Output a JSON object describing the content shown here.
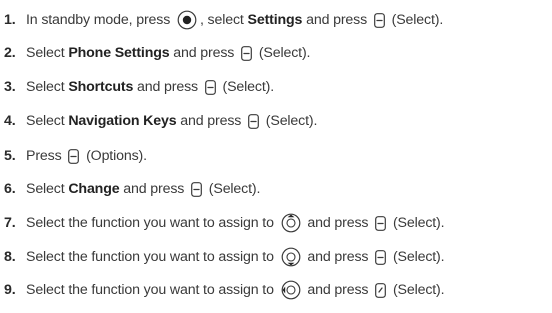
{
  "steps": [
    {
      "num": "1.",
      "parts": [
        {
          "t": "text",
          "v": "In standby mode, press "
        },
        {
          "t": "icon",
          "v": "center-key-icon"
        },
        {
          "t": "text",
          "v": ", select "
        },
        {
          "t": "bold",
          "v": "Settings"
        },
        {
          "t": "text",
          "v": " and press "
        },
        {
          "t": "icon",
          "v": "left-softkey-icon"
        },
        {
          "t": "text",
          "v": " (Select)."
        }
      ]
    },
    {
      "num": "2.",
      "parts": [
        {
          "t": "text",
          "v": "Select "
        },
        {
          "t": "bold",
          "v": "Phone Settings"
        },
        {
          "t": "text",
          "v": " and press "
        },
        {
          "t": "icon",
          "v": "left-softkey-icon"
        },
        {
          "t": "text",
          "v": " (Select)."
        }
      ]
    },
    {
      "num": "3.",
      "parts": [
        {
          "t": "text",
          "v": "Select "
        },
        {
          "t": "bold",
          "v": "Shortcuts"
        },
        {
          "t": "text",
          "v": " and press "
        },
        {
          "t": "icon",
          "v": "left-softkey-icon"
        },
        {
          "t": "text",
          "v": " (Select)."
        }
      ]
    },
    {
      "num": "4.",
      "parts": [
        {
          "t": "text",
          "v": "Select "
        },
        {
          "t": "bold",
          "v": "Navigation Keys"
        },
        {
          "t": "text",
          "v": " and press "
        },
        {
          "t": "icon",
          "v": "left-softkey-icon"
        },
        {
          "t": "text",
          "v": " (Select)."
        }
      ]
    },
    {
      "num": "5.",
      "parts": [
        {
          "t": "text",
          "v": "Press "
        },
        {
          "t": "icon",
          "v": "left-softkey-icon"
        },
        {
          "t": "text",
          "v": " (Options)."
        }
      ]
    },
    {
      "num": "6.",
      "parts": [
        {
          "t": "text",
          "v": "Select "
        },
        {
          "t": "bold",
          "v": "Change"
        },
        {
          "t": "text",
          "v": " and press "
        },
        {
          "t": "icon",
          "v": "left-softkey-icon"
        },
        {
          "t": "text",
          "v": " (Select)."
        }
      ]
    },
    {
      "num": "7.",
      "parts": [
        {
          "t": "text",
          "v": "Select the function you want to assign to "
        },
        {
          "t": "icon",
          "v": "nav-up-key-icon"
        },
        {
          "t": "text",
          "v": " and press "
        },
        {
          "t": "icon",
          "v": "left-softkey-icon"
        },
        {
          "t": "text",
          "v": " (Select)."
        }
      ]
    },
    {
      "num": "8.",
      "parts": [
        {
          "t": "text",
          "v": "Select the function you want to assign to "
        },
        {
          "t": "icon",
          "v": "nav-down-key-icon"
        },
        {
          "t": "text",
          "v": " and press "
        },
        {
          "t": "icon",
          "v": "left-softkey-icon"
        },
        {
          "t": "text",
          "v": " (Select)."
        }
      ]
    },
    {
      "num": "9.",
      "parts": [
        {
          "t": "text",
          "v": "Select the function you want to assign to "
        },
        {
          "t": "icon",
          "v": "nav-left-key-icon"
        },
        {
          "t": "text",
          "v": " and press "
        },
        {
          "t": "icon",
          "v": "right-softkey-icon"
        },
        {
          "t": "text",
          "v": " (Select)."
        }
      ]
    }
  ]
}
